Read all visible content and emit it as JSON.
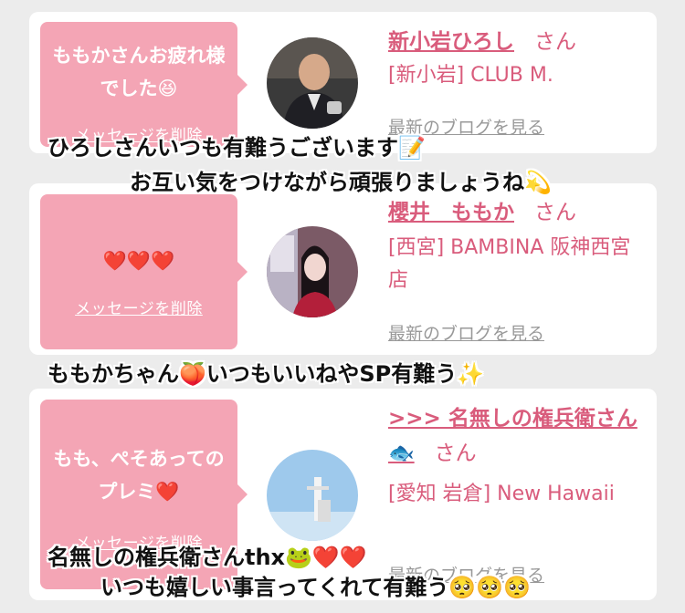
{
  "cards": [
    {
      "message": "ももかさんお疲れ様でした😆",
      "delete_label": "メッセージを削除",
      "name": "新小岩ひろし",
      "honorific": "さん",
      "shop": "[新小岩] CLUB M.",
      "blog_label": "最新のブログを見る"
    },
    {
      "message": "❤️❤️❤️",
      "delete_label": "メッセージを削除",
      "name": "櫻井　ももか",
      "honorific": "さん",
      "shop": "[西宮] BAMBINA 阪神西宮店",
      "blog_label": "最新のブログを見る"
    },
    {
      "message": "もも、ぺそあってのプレミ❤️",
      "delete_label": "メッセージを削除",
      "name": ">>> 名無しの権兵衛さん🐟",
      "honorific": "さん",
      "shop": "[愛知 岩倉] New Hawaii",
      "blog_label": "最新のブログを見る"
    }
  ],
  "overlays": {
    "line1": "ひろしさんいつも有難うございます📝",
    "line2": "お互い気をつけながら頑張りましょうね💫",
    "line3": "ももかちゃん🍑いつもいいねやSP有難う✨",
    "line4": "名無しの権兵衛さんthx🐸❤️❤️",
    "line5": "いつも嬉しい事言ってくれて有難う🥺🥺🥺"
  },
  "colors": {
    "bubble": "#f4a5b5",
    "accent": "#d95c7c",
    "background": "#ececec"
  }
}
